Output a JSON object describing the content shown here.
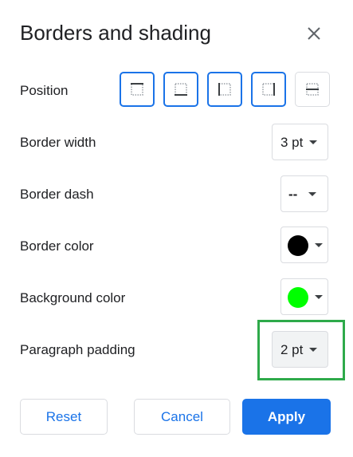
{
  "dialog": {
    "title": "Borders and shading"
  },
  "rows": {
    "position": {
      "label": "Position"
    },
    "border_width": {
      "label": "Border width",
      "value": "3 pt"
    },
    "border_dash": {
      "label": "Border dash",
      "value": "--"
    },
    "border_color": {
      "label": "Border color",
      "color": "#000000"
    },
    "background_color": {
      "label": "Background color",
      "color": "#00ff00"
    },
    "paragraph_padding": {
      "label": "Paragraph padding",
      "value": "2 pt"
    }
  },
  "position_buttons": [
    {
      "name": "top-border",
      "selected": true
    },
    {
      "name": "bottom-border",
      "selected": true
    },
    {
      "name": "left-border",
      "selected": true
    },
    {
      "name": "right-border",
      "selected": true
    },
    {
      "name": "between-border",
      "selected": false
    }
  ],
  "buttons": {
    "reset": "Reset",
    "cancel": "Cancel",
    "apply": "Apply"
  },
  "colors": {
    "accent": "#1a73e8",
    "highlight": "#2eaa4a"
  }
}
